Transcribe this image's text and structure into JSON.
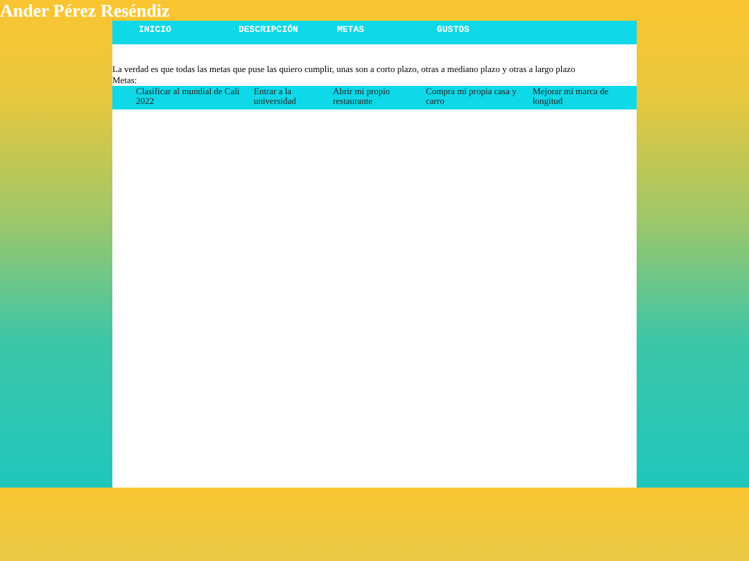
{
  "title": "Ander Pérez Reséndiz",
  "nav": [
    {
      "label": "INICIO"
    },
    {
      "label": "DESCRIPCIÓN"
    },
    {
      "label": "METAS"
    },
    {
      "label": "GUSTOS"
    }
  ],
  "intro": "La verdad es que todas las metas que puse las quiero cumplir, unas son a corto plazo, otras a mediano plazo y otras a largo plazo",
  "goals_label": "Metas:",
  "goals": [
    "Clasificar al mundial de Cali 2022",
    "Entrar a la universidad",
    "Abrir mi propio restaurante",
    "Compra mi propia casa y carro",
    "Mejorar mi marca de longitud"
  ]
}
